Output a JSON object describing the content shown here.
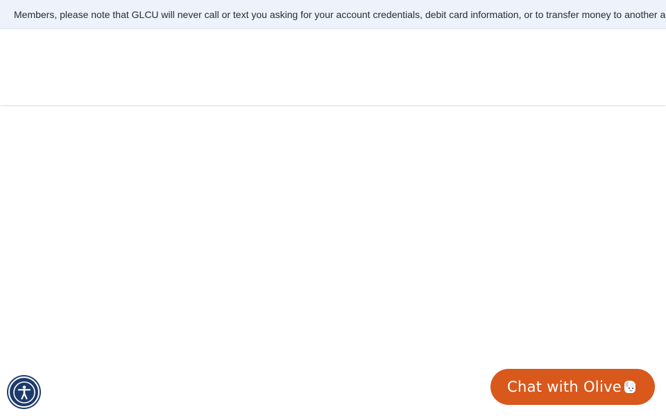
{
  "notice": {
    "text": "Members, please note that GLCU will never call or text you asking for your account credentials, debit card information, or to transfer money to another account."
  },
  "accessibility": {
    "icon": "accessibility-person-icon"
  },
  "chat": {
    "label": "Chat with Olive",
    "icon": "olive-avatar-icon",
    "color": "#d9581c"
  },
  "colors": {
    "notice_bg": "#eef3fb",
    "accessibility_bg": "#1e3a6b"
  }
}
